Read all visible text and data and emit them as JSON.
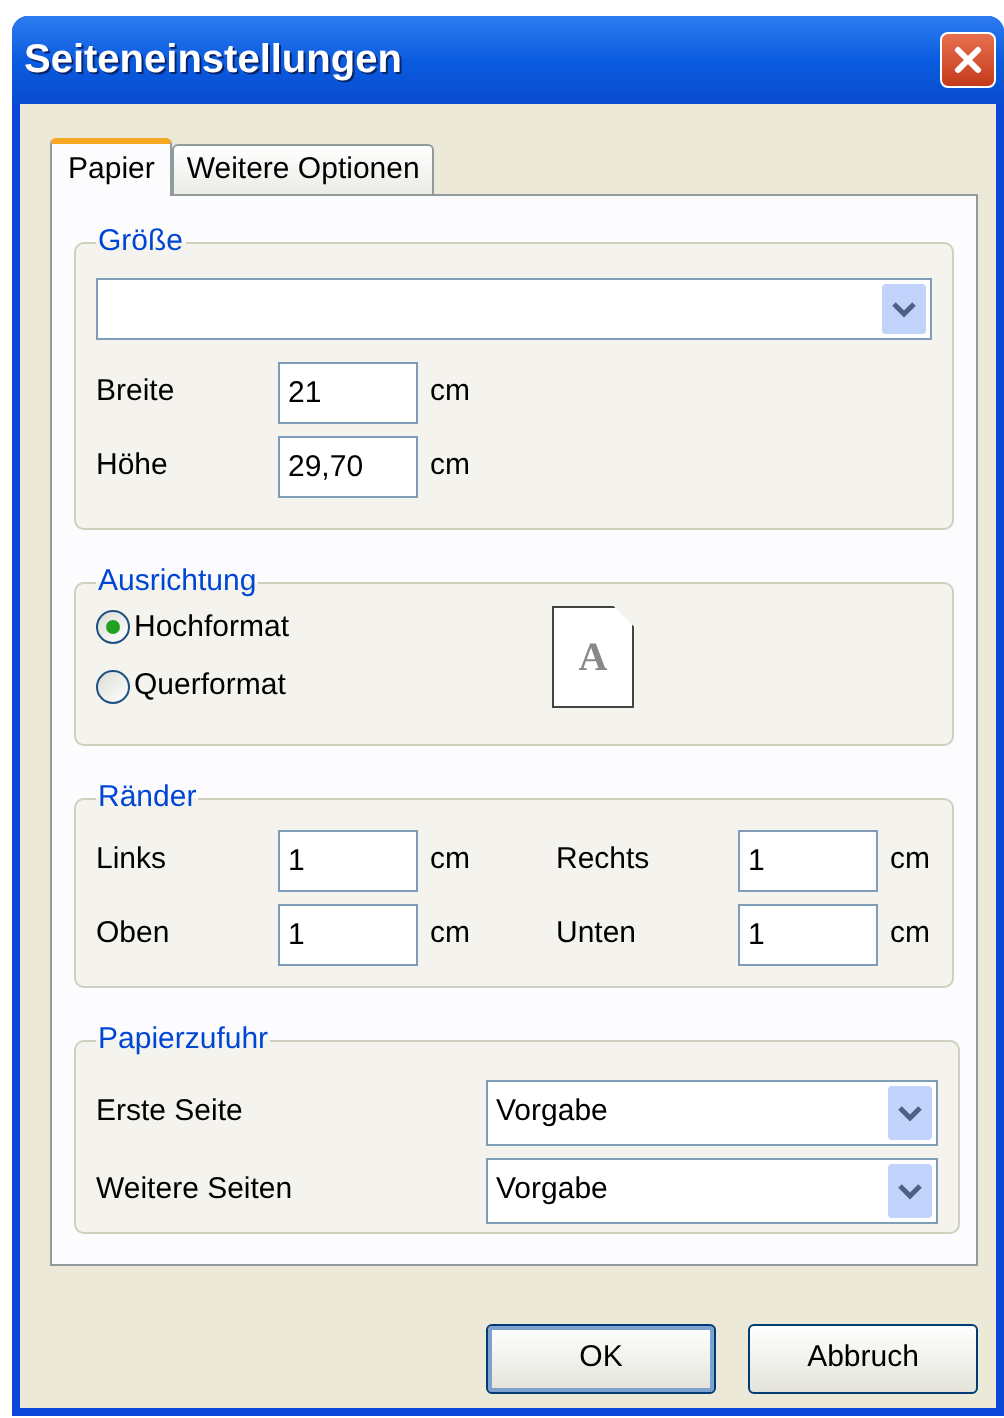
{
  "window": {
    "title": "Seiteneinstellungen"
  },
  "tabs": [
    {
      "label": "Papier",
      "selected": true
    },
    {
      "label": "Weitere Optionen",
      "selected": false
    }
  ],
  "size": {
    "legend": "Größe",
    "fields": [
      {
        "label": "Breite",
        "value": "21",
        "unit": "cm"
      },
      {
        "label": "Höhe",
        "value": "29,70",
        "unit": "cm"
      }
    ]
  },
  "orientation": {
    "legend": "Ausrichtung",
    "options": [
      {
        "label": "Hochformat",
        "selected": true
      },
      {
        "label": "Querformat",
        "selected": false
      }
    ],
    "preview_letter": "A"
  },
  "margins": {
    "legend": "Ränder",
    "fields": [
      {
        "label": "Links",
        "value": "1",
        "unit": "cm"
      },
      {
        "label": "Rechts",
        "value": "1",
        "unit": "cm"
      },
      {
        "label": "Oben",
        "value": "1",
        "unit": "cm"
      },
      {
        "label": "Unten",
        "value": "1",
        "unit": "cm"
      }
    ]
  },
  "paper_feed": {
    "legend": "Papierzufuhr",
    "rows": [
      {
        "label": "Erste Seite",
        "value": "Vorgabe"
      },
      {
        "label": "Weitere Seiten",
        "value": "Vorgabe"
      }
    ]
  },
  "buttons": [
    {
      "label": "OK",
      "default": true
    },
    {
      "label": "Abbruch",
      "default": false
    }
  ]
}
